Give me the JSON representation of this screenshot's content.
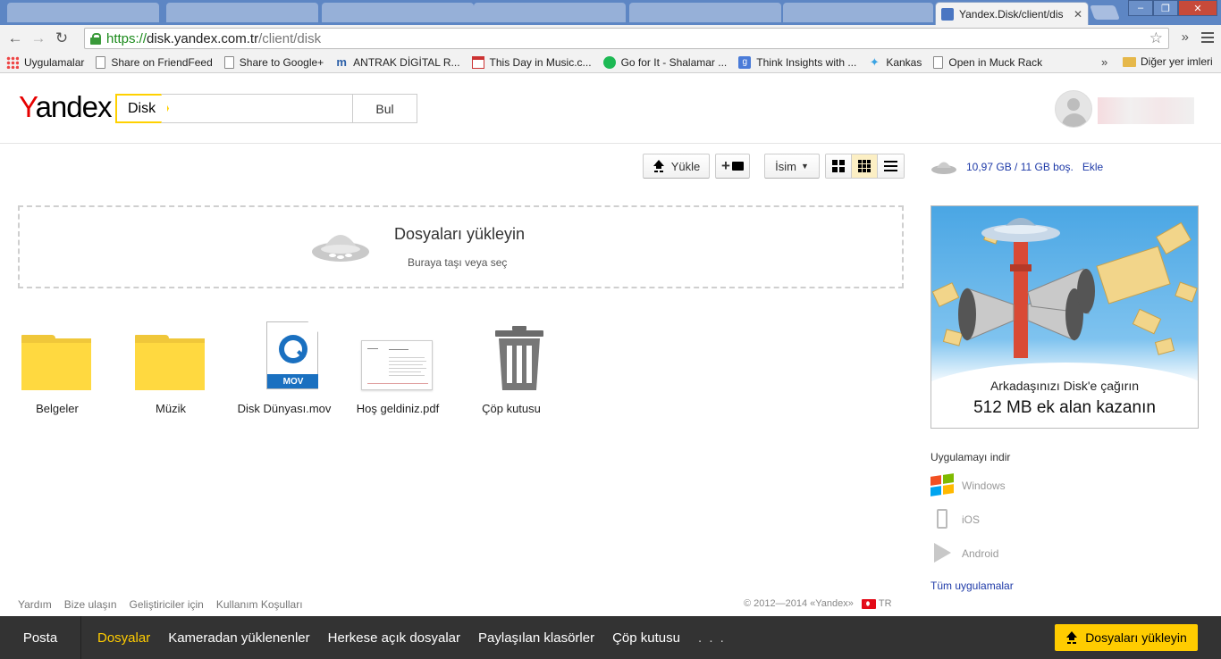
{
  "browser": {
    "active_tab_title": "Yandex.Disk/client/dis",
    "url_scheme": "https://",
    "url_host": "disk.yandex.com.tr",
    "url_path": "/client/disk",
    "bookmarks": [
      {
        "label": "Uygulamalar",
        "icon": "apps-icon"
      },
      {
        "label": "Share on FriendFeed",
        "icon": "page-icon"
      },
      {
        "label": "Share to Google+",
        "icon": "page-icon"
      },
      {
        "label": "ANTRAK DİGİTAL R...",
        "icon": "antrak-icon"
      },
      {
        "label": "This Day in Music.c...",
        "icon": "calendar-icon"
      },
      {
        "label": "Go for It - Shalamar ...",
        "icon": "spotify-icon"
      },
      {
        "label": "Think Insights with ...",
        "icon": "google-icon"
      },
      {
        "label": "Kankas",
        "icon": "twitter-icon"
      },
      {
        "label": "Open in Muck Rack",
        "icon": "page-icon"
      }
    ],
    "bookmarks_more": "»",
    "other_bookmarks": "Diğer yer imleri"
  },
  "header": {
    "logo": "Yandex",
    "search_tag": "Disk",
    "search_value": "",
    "search_button": "Bul"
  },
  "toolbar": {
    "upload_label": "Yükle",
    "new_folder_label": "+",
    "sort_label": "İsim"
  },
  "dropzone": {
    "title": "Dosyaları yükleyin",
    "subtitle": "Buraya taşı veya seç"
  },
  "files": [
    {
      "name": "Belgeler",
      "type": "folder"
    },
    {
      "name": "Müzik",
      "type": "folder"
    },
    {
      "name": "Disk Dünyası.mov",
      "type": "mov",
      "badge": "MOV"
    },
    {
      "name": "Hoş geldiniz.pdf",
      "type": "pdf"
    },
    {
      "name": "Çöp kutusu",
      "type": "trash"
    }
  ],
  "sidebar": {
    "space_text": "10,97 GB / 11 GB boş.",
    "space_add": "Ekle",
    "promo_line1": "Arkadaşınızı Disk'e çağırın",
    "promo_line2": "512 MB ek alan kazanın",
    "apps_title": "Uygulamayı indir",
    "apps": [
      {
        "label": "Windows",
        "icon": "windows-icon"
      },
      {
        "label": "iOS",
        "icon": "ios-icon"
      },
      {
        "label": "Android",
        "icon": "android-icon"
      }
    ],
    "all_apps": "Tüm uygulamalar"
  },
  "footer": {
    "links": [
      "Yardım",
      "Bize ulaşın",
      "Geliştiriciler için",
      "Kullanım Koşulları"
    ],
    "copyright": "© 2012—2014 «Yandex»",
    "lang": "TR"
  },
  "bottom_nav": {
    "posta": "Posta",
    "items": [
      "Dosyalar",
      "Kameradan yüklenenler",
      "Herkese açık dosyalar",
      "Paylaşılan klasörler",
      "Çöp kutusu"
    ],
    "active_index": 0,
    "more": ". . .",
    "upload_button": "Dosyaları yükleyin"
  },
  "colors": {
    "accent_yellow": "#ffcc00",
    "link_blue": "#1e3aa8",
    "bottom_bar": "#333333"
  }
}
